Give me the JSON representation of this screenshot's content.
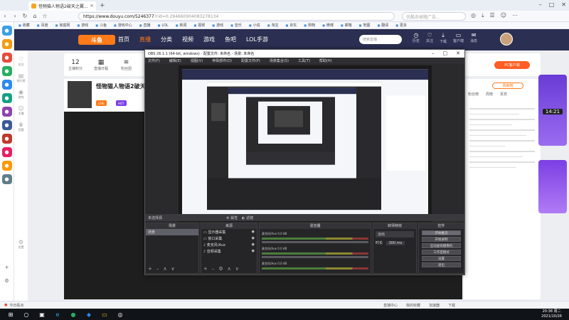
{
  "browser": {
    "tab_title": "怪物猫人物语2破天之翼...",
    "address_host": "https://www.douyu.com/5246377",
    "address_path": "?rid=0.294660904083278134",
    "search_placeholder": "优酷去掉路广告...",
    "bookmarks": [
      "收藏",
      "百度",
      "家庭网",
      "游戏",
      "斗鱼",
      "游戏中心",
      "直播",
      "LOL",
      "新闻",
      "视频",
      "游戏",
      "音乐",
      "小说",
      "淘宝",
      "京东",
      "购物",
      "微博",
      "邮箱",
      "地图",
      "翻译",
      "更多"
    ]
  },
  "douyu": {
    "logo": "斗鱼",
    "nav": [
      "首页",
      "直播",
      "分类",
      "视频",
      "游戏",
      "鱼吧",
      "LOL手游"
    ],
    "search_placeholder": "搜索直播",
    "header_icons": [
      "历史",
      "关注",
      "下载",
      "客户端",
      "消息"
    ],
    "stats": [
      {
        "value": "12",
        "label": "主播积分"
      },
      {
        "value": "",
        "label": "直播日程"
      },
      {
        "value": "",
        "label": "粉丝团"
      }
    ],
    "room_title": "怪物猫人物语2破天之",
    "pc_button": "PC客户端",
    "rank_button": "贡献榜",
    "chat_tabs": [
      "粉丝榜",
      "周榜",
      "贵宾"
    ],
    "rail": [
      "关注",
      "排行榜",
      "游戏",
      "主播",
      "竞猜",
      "设置"
    ],
    "promo_time": "14:21"
  },
  "obs": {
    "title": "OBS 26.1.1 (64-bit, windows) - 配置文件: 未命名 - 场景: 未命名",
    "menu": [
      "文件(F)",
      "编辑(E)",
      "视图(V)",
      "停靠部件(D)",
      "配置文件(P)",
      "场景集合(S)",
      "工具(T)",
      "帮助(H)"
    ],
    "preview_label": "未选择源",
    "toolbar_props": "属性",
    "toolbar_filters": "滤镜",
    "docks": {
      "scenes": {
        "title": "场景",
        "items": [
          "场景"
        ]
      },
      "sources": {
        "title": "来源",
        "items": [
          "显示器采集",
          "窗口采集",
          "麦克风/Aux",
          "音频采集"
        ]
      },
      "mixer": {
        "title": "混音器",
        "rows": [
          {
            "name": "麦克风/Aux",
            "db": "0.0 dB"
          },
          {
            "name": "麦克风/Aux",
            "db": "0.0 dB"
          },
          {
            "name": "麦克风/Aux",
            "db": "0.0 dB"
          }
        ]
      },
      "transitions": {
        "title": "转场特效",
        "type": "淡出",
        "duration_label": "时长",
        "duration": "300 ms"
      },
      "controls": {
        "title": "控件",
        "buttons": [
          "开始推流",
          "开始录制",
          "启动虚拟摄像机",
          "工作室模式",
          "设置",
          "退出"
        ]
      }
    }
  },
  "footer": {
    "left": "今日看点",
    "items": [
      "直播中心",
      "我的收藏",
      "加速器",
      "下载"
    ]
  },
  "taskbar": {
    "time": "20:38 周二",
    "date": "2021/10/26"
  }
}
